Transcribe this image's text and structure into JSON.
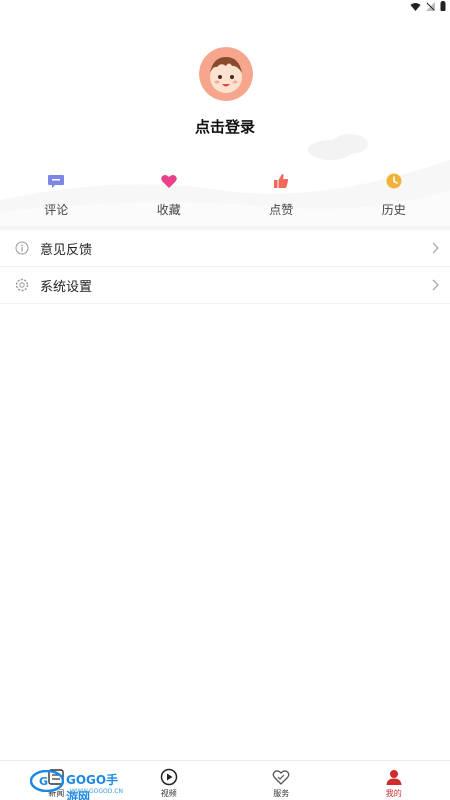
{
  "status_bar": {
    "icons": [
      "wifi-icon",
      "signal-icon",
      "battery-icon"
    ]
  },
  "profile": {
    "login_label": "点击登录"
  },
  "quick_actions": [
    {
      "label": "评论",
      "icon": "comment-icon",
      "color": "#7b86e6"
    },
    {
      "label": "收藏",
      "icon": "heart-icon",
      "color": "#e9418a"
    },
    {
      "label": "点赞",
      "icon": "thumbs-up-icon",
      "color": "#f0695b"
    },
    {
      "label": "历史",
      "icon": "clock-icon",
      "color": "#f2b23a"
    }
  ],
  "menu": [
    {
      "label": "意见反馈",
      "icon": "info-icon"
    },
    {
      "label": "系统设置",
      "icon": "settings-icon"
    }
  ],
  "tabbar": [
    {
      "label": "新闻",
      "icon": "news-icon",
      "active": false
    },
    {
      "label": "视频",
      "icon": "play-icon",
      "active": false
    },
    {
      "label": "服务",
      "icon": "service-heart-icon",
      "active": false
    },
    {
      "label": "我的",
      "icon": "user-icon",
      "active": true
    }
  ],
  "watermark": {
    "text": "GOGO手游网",
    "sub": "WWW.GOGOD.CN"
  },
  "colors": {
    "accent": "#d12a2a",
    "background": "#ffffff"
  }
}
